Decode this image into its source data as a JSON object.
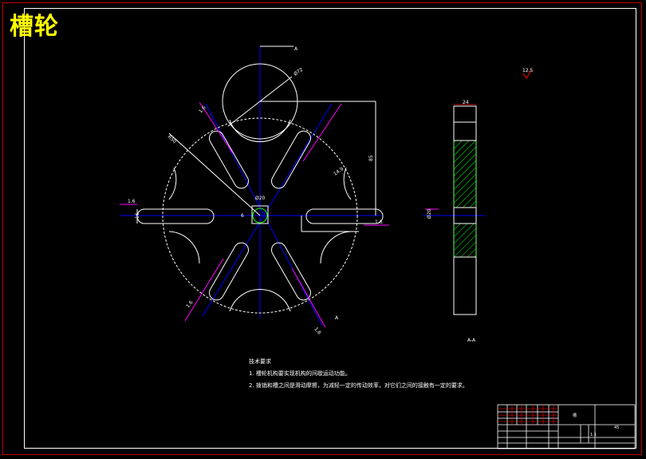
{
  "title": "槽轮",
  "dimensions": {
    "top_marker": "A",
    "chord": "Ø72",
    "radius_left": "R50",
    "vertical_height": "85",
    "slot_width_diag": "14.9",
    "hub_dia": "Ø20",
    "hub_key": "6",
    "slot_left_height": "16",
    "left_roughness": "1.6",
    "right_roughness": "1.6",
    "upper_left_roughness": "1.6",
    "lower_left_roughness": "1.6",
    "lower_right_roughness": "1.6",
    "side_top_width": "24",
    "side_bore": "Ø20",
    "side_label_bottom": "A-A",
    "global_roughness": "12.5",
    "section_marker": "A"
  },
  "notes": {
    "heading": "技术要求",
    "item1": "1. 槽轮机构要实现机构的间歇运动功能。",
    "item2": "2. 拨销和槽之间是滑动摩擦，为减轻一定的传动效率，对它们之间的接触有一定的要求。"
  },
  "title_block": {
    "part_name": "槽",
    "material": "45",
    "scale": "1:1",
    "code": " "
  },
  "colors": {
    "background": "#000000",
    "outline": "#ffffff",
    "centerline": "#0000ff",
    "dimension": "#ff00ff",
    "section_hatch": "#00ff00",
    "title": "#ffff00",
    "frame": "#c00000"
  }
}
